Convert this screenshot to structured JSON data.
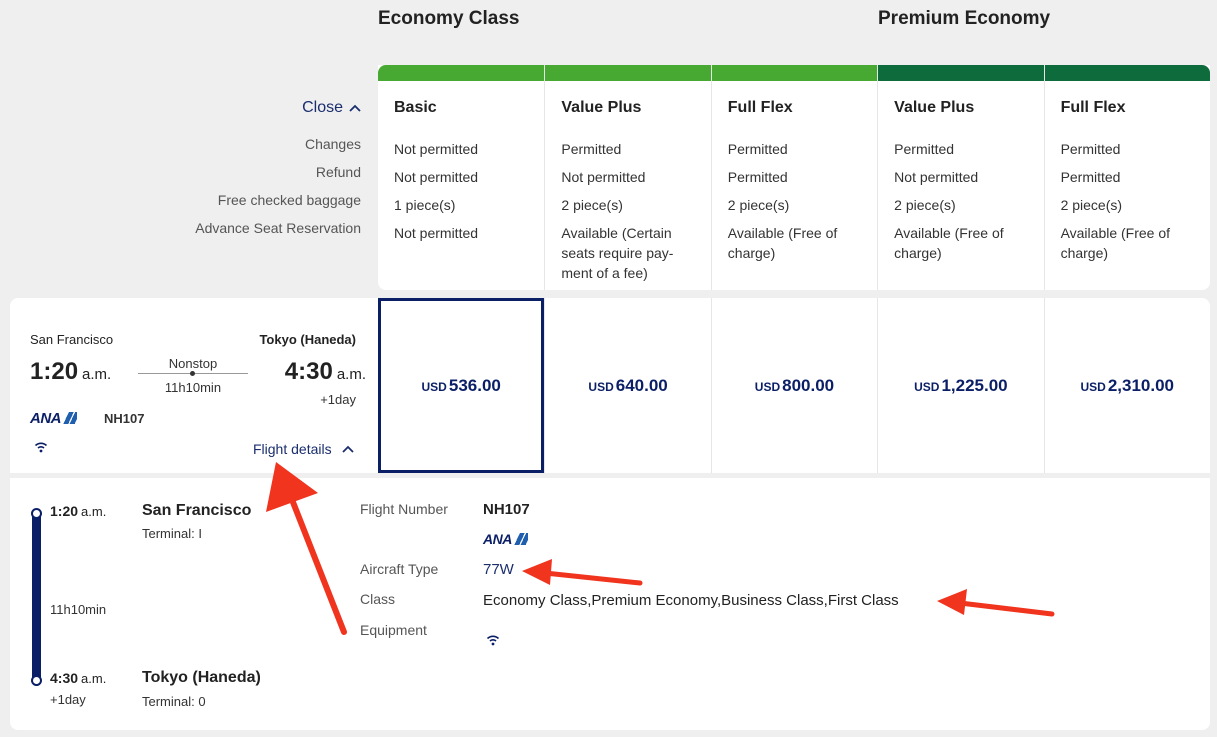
{
  "class_headings": {
    "economy": "Economy Class",
    "premium": "Premium Economy"
  },
  "attributes": {
    "close_label": "Close",
    "labels": [
      "Changes",
      "Refund",
      "Free checked baggage",
      "Advance Seat Reservation"
    ]
  },
  "fares": [
    {
      "name": "Basic",
      "group": "economy",
      "changes": "Not permitted",
      "refund": "Not permitted",
      "baggage": "1 piece(s)",
      "seat": "Not permitted",
      "currency": "USD",
      "price": "536.00"
    },
    {
      "name": "Value Plus",
      "group": "economy",
      "changes": "Permitted",
      "refund": "Not permitted",
      "baggage": "2 piece(s)",
      "seat": "Available (Certain seats require pay-ment of a fee)",
      "currency": "USD",
      "price": "640.00"
    },
    {
      "name": "Full Flex",
      "group": "economy",
      "changes": "Permitted",
      "refund": "Permitted",
      "baggage": "2 piece(s)",
      "seat": "Available (Free of charge)",
      "currency": "USD",
      "price": "800.00"
    },
    {
      "name": "Value Plus",
      "group": "premium",
      "changes": "Permitted",
      "refund": "Not permitted",
      "baggage": "2 piece(s)",
      "seat": "Available (Free of charge)",
      "currency": "USD",
      "price": "1,225.00"
    },
    {
      "name": "Full Flex",
      "group": "premium",
      "changes": "Permitted",
      "refund": "Permitted",
      "baggage": "2 piece(s)",
      "seat": "Available (Free of charge)",
      "currency": "USD",
      "price": "2,310.00"
    }
  ],
  "flight": {
    "departure_city": "San Francisco",
    "departure_time": "1:20",
    "departure_ampm": "a.m.",
    "arrival_city": "Tokyo (Haneda)",
    "arrival_time": "4:30",
    "arrival_ampm": "a.m.",
    "plus_day": "+1day",
    "stops": "Nonstop",
    "duration": "11h10min",
    "airline_logo": "ANA",
    "flight_number": "NH107",
    "details_label": "Flight details"
  },
  "details": {
    "dep_time": "1:20",
    "dep_ampm": "a.m.",
    "dep_city": "San Francisco",
    "dep_terminal": "Terminal: I",
    "duration": "11h10min",
    "arr_time": "4:30",
    "arr_ampm": "a.m.",
    "arr_plus_day": "+1day",
    "arr_city": "Tokyo (Haneda)",
    "arr_terminal": "Terminal: 0",
    "flight_number_label": "Flight Number",
    "flight_number": "NH107",
    "airline_logo": "ANA",
    "aircraft_label": "Aircraft Type",
    "aircraft": "77W",
    "class_label": "Class",
    "classes": "Economy Class,Premium Economy,Business Class,First Class",
    "equipment_label": "Equipment",
    "equipment_icon": "wifi-icon"
  },
  "colors": {
    "economy": "#47a832",
    "premium": "#0d6b3c",
    "navy": "#0b1f66",
    "annotation": "#f0341e"
  }
}
